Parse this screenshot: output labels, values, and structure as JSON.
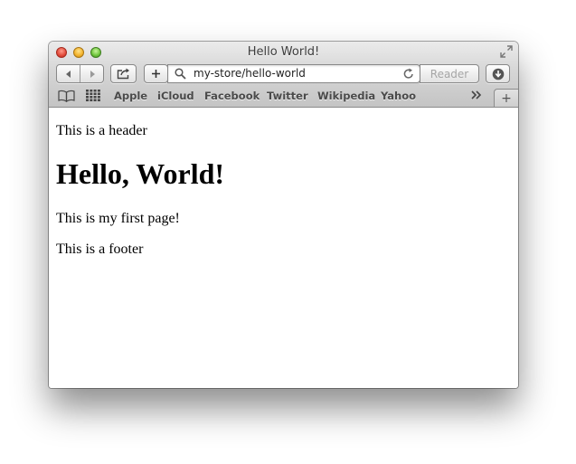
{
  "window": {
    "title": "Hello World!"
  },
  "toolbar": {
    "back_icon": "back-arrow-icon",
    "forward_icon": "forward-arrow-icon",
    "share_icon": "share-icon",
    "add_icon": "plus-icon",
    "address": {
      "url": "my-store/hello-world",
      "search_icon": "magnifier-icon",
      "reload_icon": "reload-icon"
    },
    "reader_label": "Reader",
    "download_icon": "download-icon"
  },
  "bookmarks": {
    "reading_list_icon": "book-icon",
    "top_sites_icon": "grid-icon",
    "items": [
      "Apple",
      "iCloud",
      "Facebook",
      "Twitter",
      "Wikipedia",
      "Yahoo"
    ],
    "more_icon": "chevron-double-right-icon",
    "new_tab_label": "+"
  },
  "page": {
    "header": "This is a header",
    "heading": "Hello, World!",
    "body": "This is my first page!",
    "footer": "This is a footer"
  }
}
